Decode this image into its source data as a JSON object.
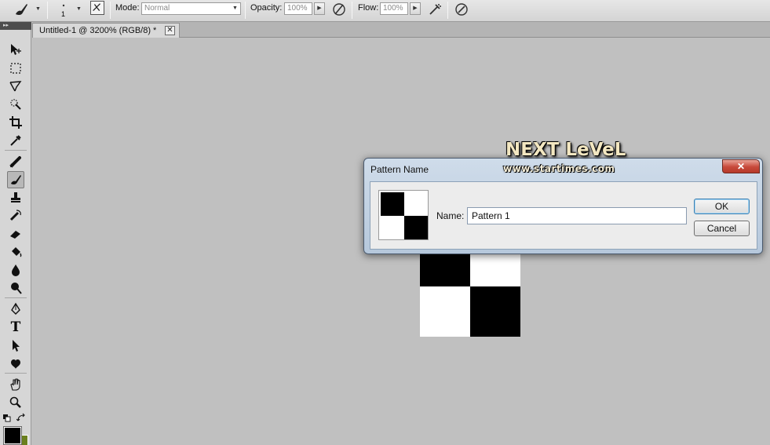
{
  "options_bar": {
    "brush_size": "1",
    "mode_label": "Mode:",
    "mode_value": "Normal",
    "opacity_label": "Opacity:",
    "opacity_value": "100%",
    "flow_label": "Flow:",
    "flow_value": "100%",
    "icons": [
      "brush-tool-icon",
      "brush-preset-picker-icon",
      "brush-panel-toggle-icon",
      "pressure-opacity-icon",
      "airbrush-icon",
      "pressure-size-icon"
    ]
  },
  "tools_panel": {
    "header_glyph": "▸▸",
    "tools": [
      "move-tool-icon",
      "marquee-tool-icon",
      "lasso-tool-icon",
      "quick-selection-tool-icon",
      "crop-tool-icon",
      "eyedropper-tool-icon",
      "spot-healing-tool-icon",
      "brush-tool-icon",
      "clone-stamp-tool-icon",
      "history-brush-tool-icon",
      "eraser-tool-icon",
      "paint-bucket-tool-icon",
      "blur-tool-icon",
      "dodge-tool-icon",
      "pen-tool-icon",
      "type-tool-icon",
      "path-selection-tool-icon",
      "custom-shape-tool-icon",
      "hand-tool-icon",
      "zoom-tool-icon"
    ],
    "active_tool": "brush-tool-icon",
    "type_tool_glyph": "T",
    "foreground_color": "#000000",
    "background_color": "#6b7f1e"
  },
  "document": {
    "tab_title": "Untitled-1 @ 3200% (RGB/8) *",
    "tab_close": "✕"
  },
  "watermark": {
    "title": "NEXT LeVeL",
    "subtitle": "www.startimes.com"
  },
  "dialog": {
    "title": "Pattern Name",
    "close_glyph": "✕",
    "name_label": "Name:",
    "name_value": "Pattern 1",
    "ok_label": "OK",
    "cancel_label": "Cancel"
  },
  "colors": {
    "workspace": "#c0c0c0",
    "dialog_close": "#c7493a",
    "ok_focus": "#3c7fb1"
  }
}
